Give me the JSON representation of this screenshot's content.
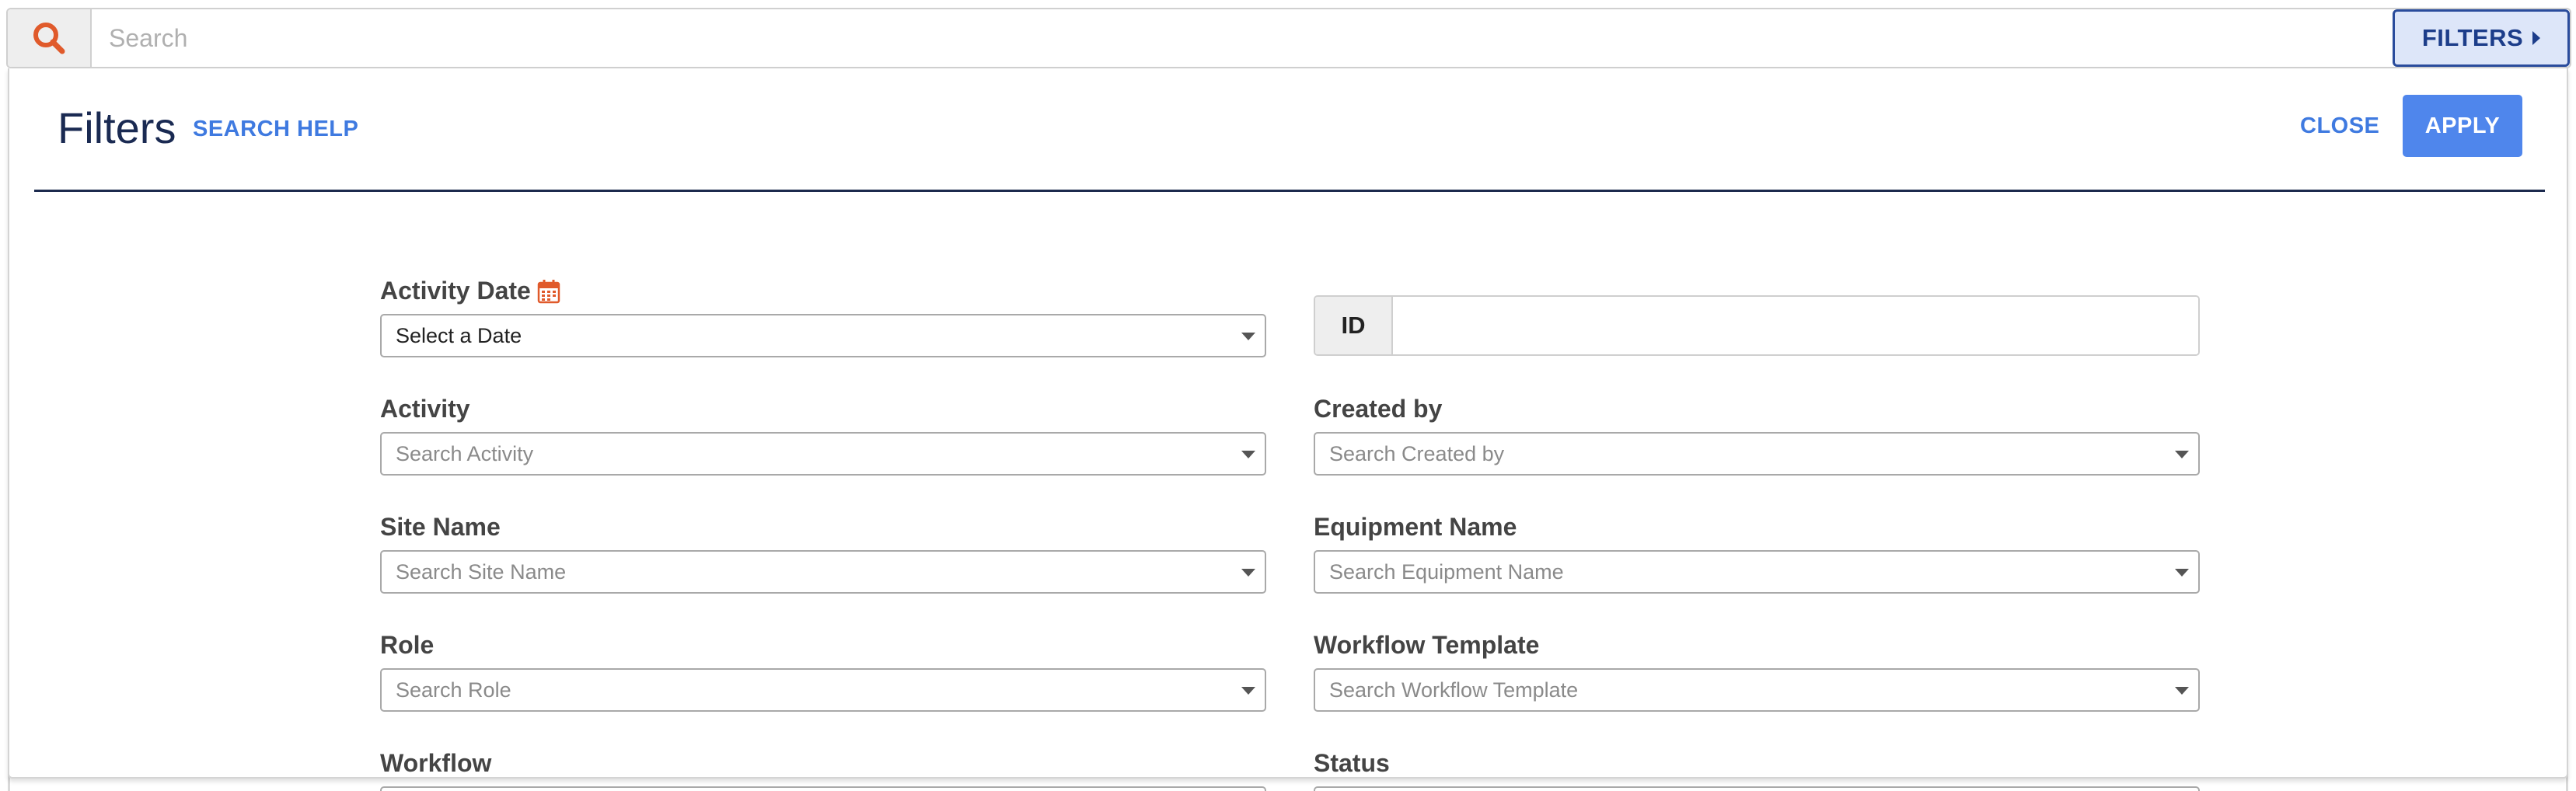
{
  "search": {
    "placeholder": "Search",
    "value": "",
    "icon": "search-icon",
    "filters_toggle_label": "FILTERS",
    "accent": "#e05a2b"
  },
  "filters_panel": {
    "title": "Filters",
    "search_help_label": "SEARCH HELP",
    "close_label": "CLOSE",
    "apply_label": "APPLY",
    "apply_color": "#4f86ec",
    "link_color": "#3f7ae0"
  },
  "fields": {
    "activity_date": {
      "label": "Activity Date",
      "value": "Select a Date",
      "icon": "calendar-icon"
    },
    "id": {
      "label": "ID",
      "value": ""
    },
    "activity": {
      "label": "Activity",
      "placeholder": "Search Activity"
    },
    "created_by": {
      "label": "Created by",
      "placeholder": "Search Created by"
    },
    "site_name": {
      "label": "Site Name",
      "placeholder": "Search Site Name"
    },
    "equipment_name": {
      "label": "Equipment Name",
      "placeholder": "Search Equipment Name"
    },
    "role": {
      "label": "Role",
      "placeholder": "Search Role"
    },
    "workflow_template": {
      "label": "Workflow Template",
      "placeholder": "Search Workflow Template"
    },
    "workflow": {
      "label": "Workflow"
    },
    "status": {
      "label": "Status"
    }
  }
}
